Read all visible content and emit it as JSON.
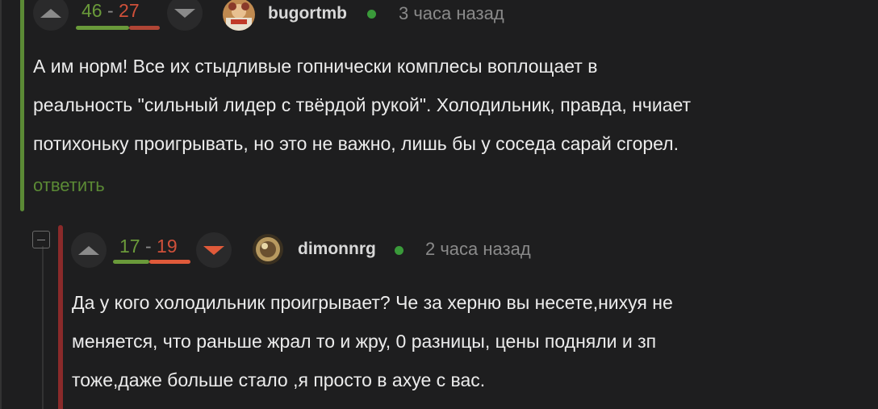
{
  "comment1": {
    "votes_up": "46",
    "separator": "-",
    "votes_down": "27",
    "username": "bugortmb",
    "time": "3 часа назад",
    "lines": [
      "А им норм! Все их стыдливые гопнически комплесы воплощает в",
      "реальность \"сильный лидер с твёрдой рукой\". Холодильник, правда, нчиает",
      "потихоньку проигрывать, но это не важно, лишь бы у соседа сарай сгорел."
    ],
    "reply_label": "ответить",
    "colors": {
      "thread": "#5b8a35",
      "positive": "#6a9a3a",
      "negative": "#d0503a"
    }
  },
  "comment2": {
    "votes_up": "17",
    "separator": "-",
    "votes_down": "19",
    "username": "dimonnrg",
    "time": "2 часа назад",
    "lines": [
      "Да у кого холодильник проигрывает? Че за херню вы несете,нихуя не",
      "меняется, что раньше жрал то и жру, 0 разницы, цены подняли и зп",
      "тоже,даже больше стало ,я просто в ахуе с вас."
    ],
    "colors": {
      "thread": "#8a2a2a",
      "downvote_active": "#e05a3a"
    }
  }
}
